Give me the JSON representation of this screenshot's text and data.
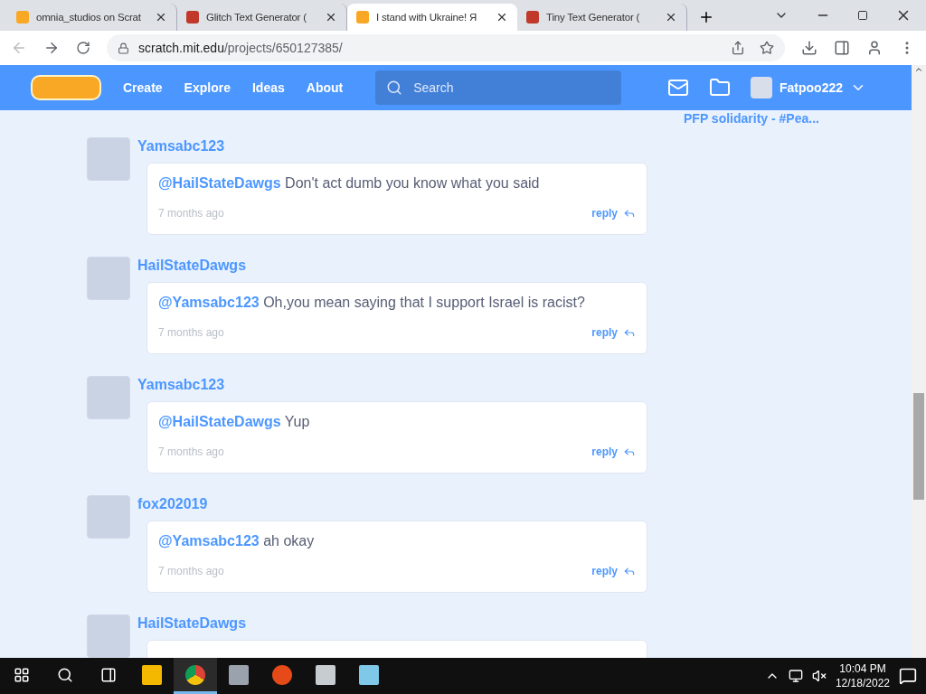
{
  "browser": {
    "tabs": [
      {
        "title": "omnia_studios on Scrat",
        "selected": false
      },
      {
        "title": "Glitch Text Generator (",
        "selected": false
      },
      {
        "title": "I stand with Ukraine! Я",
        "selected": true
      },
      {
        "title": "Tiny Text Generator (",
        "selected": false
      }
    ],
    "url_host": "scratch.mit.edu",
    "url_path": "/projects/650127385/"
  },
  "nav": {
    "links": [
      "Create",
      "Explore",
      "Ideas",
      "About"
    ],
    "search": {
      "placeholder": "Search"
    },
    "username": "Fatpoo222"
  },
  "sidebar": {
    "link": "PFP solidarity - #Pea..."
  },
  "comments": [
    {
      "author": "Yamsabc123",
      "mention": "@HailStateDawgs",
      "text": " Don't act dumb you know what you said",
      "time": "7 months ago",
      "reply": "reply"
    },
    {
      "author": "HailStateDawgs",
      "mention": "@Yamsabc123",
      "text": " Oh,you mean saying that I support Israel is racist?",
      "time": "7 months ago",
      "reply": "reply"
    },
    {
      "author": "Yamsabc123",
      "mention": "@HailStateDawgs",
      "text": " Yup",
      "time": "7 months ago",
      "reply": "reply"
    },
    {
      "author": "fox202019",
      "mention": "@Yamsabc123",
      "text": " ah okay",
      "time": "7 months ago",
      "reply": "reply"
    },
    {
      "author": "HailStateDawgs"
    }
  ],
  "taskbar": {
    "apps": [
      {
        "kind": "explorer",
        "selected": false
      },
      {
        "kind": "chrome",
        "selected": true
      },
      {
        "kind": "computer",
        "selected": false
      },
      {
        "kind": "p",
        "selected": false
      },
      {
        "kind": "drive",
        "selected": false
      },
      {
        "kind": "notebook",
        "selected": false
      }
    ],
    "time": "10:04 PM",
    "date": "12/18/2022"
  }
}
